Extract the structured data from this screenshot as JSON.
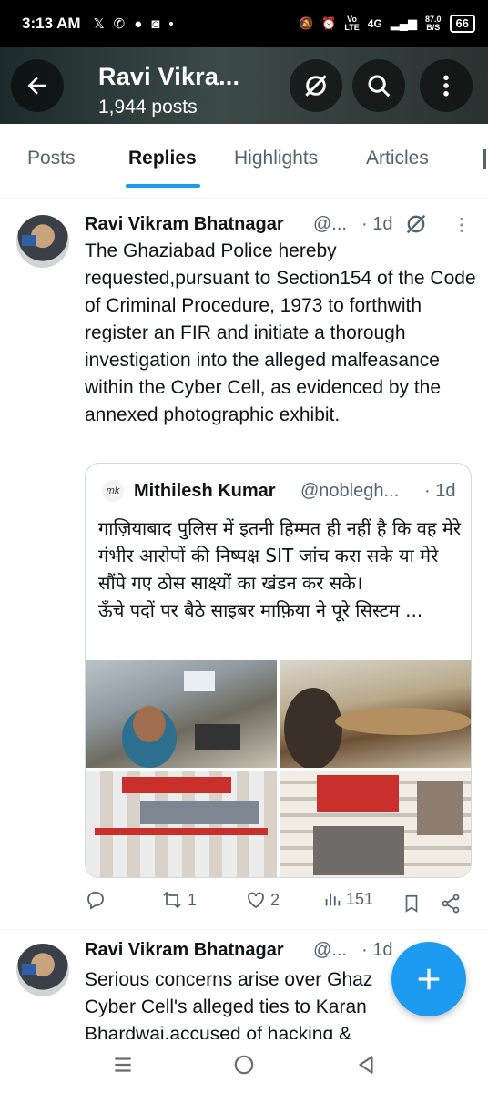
{
  "status_bar": {
    "time": "3:13 AM",
    "notification_icons": [
      "x-icon",
      "whatsapp-icon",
      "chat-icon",
      "instagram-icon",
      "dot-icon"
    ],
    "vo_lte": "Vo",
    "lte": "LTE",
    "network": "4G",
    "speed_value": "87.0",
    "speed_unit": "B/S",
    "battery": "66"
  },
  "header": {
    "title": "Ravi Vikra...",
    "post_count": "1,944 posts"
  },
  "tabs": [
    {
      "label": "Posts",
      "active": false
    },
    {
      "label": "Replies",
      "active": true
    },
    {
      "label": "Highlights",
      "active": false
    },
    {
      "label": "Articles",
      "active": false
    }
  ],
  "tweets": [
    {
      "author_name": "Ravi Vikram Bhatnagar",
      "handle": "@...",
      "time": "· 1d",
      "text": "The Ghaziabad Police hereby requested,pursuant to Section154 of the Code of Criminal Procedure, 1973 to forthwith register an FIR and initiate a thorough investigation into the alleged malfeasance within the Cyber Cell, as evidenced by the annexed photographic exhibit.",
      "quote": {
        "avatar_text": "mk",
        "author_name": "Mithilesh Kumar",
        "handle": "@noblegh...",
        "time": "· 1d",
        "text": "गाज़ियाबाद पुलिस में इतनी हिम्मत ही नहीं है कि वह मेरे गंभीर आरोपों की निष्पक्ष SIT जांच करा सके या मेरे सौंपे गए ठोस साक्ष्यों का खंडन कर सके।\nऊँचे पदों पर बैठे साइबर माफ़िया ने पूरे सिस्टम ..."
      },
      "actions": {
        "reply": "",
        "retweet": "1",
        "like": "2",
        "views": "151"
      }
    },
    {
      "author_name": "Ravi Vikram Bhatnagar",
      "handle": "@...",
      "time": "· 1d",
      "text": "Serious concerns arise over Ghaz Cyber Cell's alleged ties to Karan Bhardwaj,accused of hacking &"
    }
  ],
  "colors": {
    "accent": "#1d9bf0",
    "secondary_text": "#536471",
    "border": "#cfd9de"
  }
}
